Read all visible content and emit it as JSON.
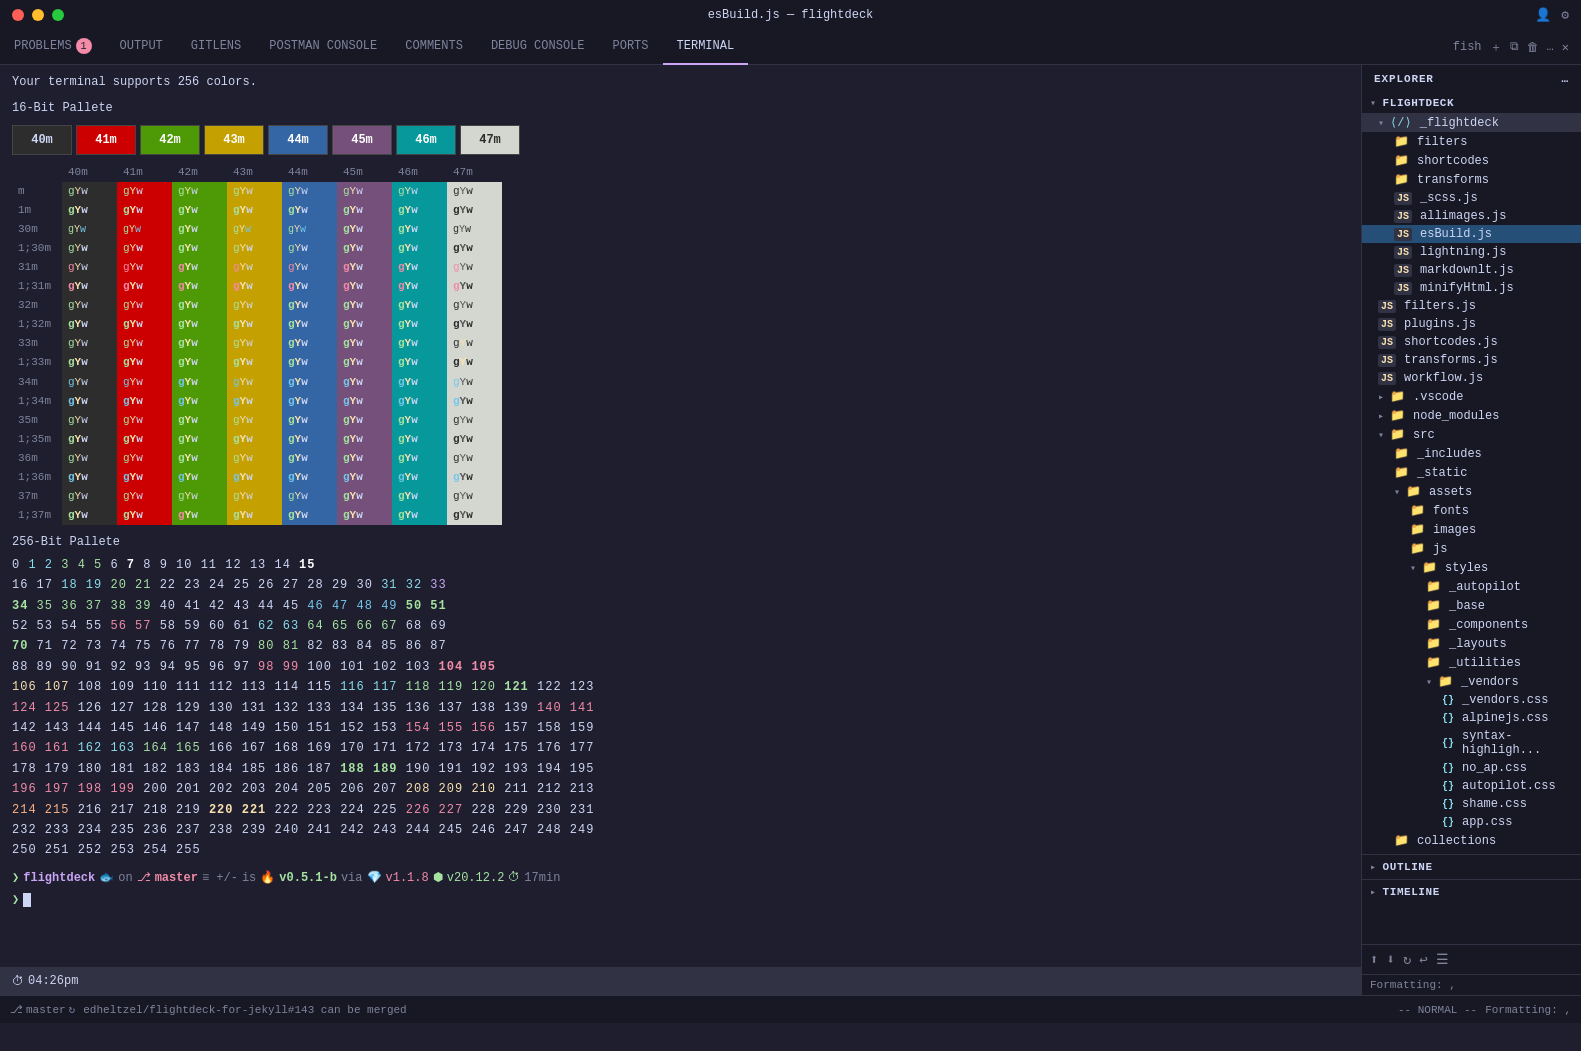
{
  "window": {
    "title": "esBuild.js — flightdeck"
  },
  "traffic_lights": [
    "red",
    "yellow",
    "green"
  ],
  "tabs": [
    {
      "label": "PROBLEMS",
      "badge": "1",
      "active": false
    },
    {
      "label": "OUTPUT",
      "active": false
    },
    {
      "label": "GITLENS",
      "active": false
    },
    {
      "label": "POSTMAN CONSOLE",
      "active": false
    },
    {
      "label": "COMMENTS",
      "active": false
    },
    {
      "label": "DEBUG CONSOLE",
      "active": false
    },
    {
      "label": "PORTS",
      "active": false
    },
    {
      "label": "TERMINAL",
      "active": true
    }
  ],
  "terminal": {
    "line1": "Your terminal supports 256 colors.",
    "section1": "16-Bit Pallete",
    "section2": "256-Bit Pallete",
    "palette_boxes": [
      {
        "label": "40m",
        "bg": "#2d2d2d",
        "color": "#cdd6f4"
      },
      {
        "label": "41m",
        "bg": "#cc0000",
        "color": "#ffffff"
      },
      {
        "label": "42m",
        "bg": "#4e9a06",
        "color": "#ffffff"
      },
      {
        "label": "43m",
        "bg": "#c4a000",
        "color": "#ffffff"
      },
      {
        "label": "44m",
        "bg": "#3465a4",
        "color": "#ffffff"
      },
      {
        "label": "45m",
        "bg": "#75507b",
        "color": "#ffffff"
      },
      {
        "label": "46m",
        "bg": "#06989a",
        "color": "#ffffff"
      },
      {
        "label": "47m",
        "bg": "#d3d7cf",
        "color": "#2d2d2d"
      }
    ]
  },
  "prompt": {
    "arrow": "❯",
    "dir": "flightdeck",
    "git_icon": "⎇",
    "branch": "master",
    "indicator": "≡ +/-",
    "status": "is",
    "version": "v0.5.1-b",
    "via": "via",
    "ruby_icon": "💎",
    "ruby_version": "v1.1.8",
    "node_icon": "⬢",
    "node_version": "v20.12.2",
    "time_icon": "⏱",
    "time": "17min"
  },
  "statusbar": {
    "time": "04:26pm"
  },
  "bottombar": {
    "branch": "master",
    "sync": "↻",
    "pr_label": "edheltzel/flightdeck-for-jekyll#143 can be merged",
    "mode": "-- NORMAL --",
    "formatting": "Formatting: ,"
  },
  "explorer": {
    "title": "EXPLORER",
    "sections": [
      {
        "name": "FLIGHTDECK",
        "expanded": true,
        "items": [
          {
            "type": "folder",
            "label": "_flightdeck",
            "indent": 0,
            "expanded": true
          },
          {
            "type": "folder",
            "label": "filters",
            "indent": 1
          },
          {
            "type": "folder",
            "label": "shortcodes",
            "indent": 1
          },
          {
            "type": "folder",
            "label": "transforms",
            "indent": 1
          },
          {
            "type": "js-file",
            "label": "_scss.js",
            "indent": 1
          },
          {
            "type": "js-file",
            "label": "allimages.js",
            "indent": 1
          },
          {
            "type": "js-file",
            "label": "esBuild.js",
            "indent": 1,
            "active": true
          },
          {
            "type": "js-file",
            "label": "lightning.js",
            "indent": 1
          },
          {
            "type": "js-file",
            "label": "markdownlt.js",
            "indent": 1
          },
          {
            "type": "js-file",
            "label": "minifyHtml.js",
            "indent": 1
          },
          {
            "type": "js-file",
            "label": "filters.js",
            "indent": 0
          },
          {
            "type": "js-file",
            "label": "plugins.js",
            "indent": 0
          },
          {
            "type": "js-file",
            "label": "shortcodes.js",
            "indent": 0
          },
          {
            "type": "js-file",
            "label": "transforms.js",
            "indent": 0
          },
          {
            "type": "js-file",
            "label": "workflow.js",
            "indent": 0
          },
          {
            "type": "folder",
            "label": ".vscode",
            "indent": 0
          },
          {
            "type": "folder",
            "label": "node_modules",
            "indent": 0
          },
          {
            "type": "folder",
            "label": "src",
            "indent": 0,
            "expanded": true
          },
          {
            "type": "folder",
            "label": "_includes",
            "indent": 1
          },
          {
            "type": "folder",
            "label": "_static",
            "indent": 1
          },
          {
            "type": "folder",
            "label": "assets",
            "indent": 1,
            "expanded": true
          },
          {
            "type": "folder",
            "label": "fonts",
            "indent": 2
          },
          {
            "type": "folder",
            "label": "images",
            "indent": 2
          },
          {
            "type": "folder",
            "label": "js",
            "indent": 2
          },
          {
            "type": "folder",
            "label": "styles",
            "indent": 2,
            "expanded": true
          },
          {
            "type": "folder",
            "label": "_autopilot",
            "indent": 3
          },
          {
            "type": "folder",
            "label": "_base",
            "indent": 3
          },
          {
            "type": "folder",
            "label": "_components",
            "indent": 3
          },
          {
            "type": "folder",
            "label": "_layouts",
            "indent": 3
          },
          {
            "type": "folder",
            "label": "_utilities",
            "indent": 3
          },
          {
            "type": "folder",
            "label": "_vendors",
            "indent": 3
          },
          {
            "type": "css-file",
            "label": "_vendors.css",
            "indent": 4
          },
          {
            "type": "css-file",
            "label": "alpinejs.css",
            "indent": 4
          },
          {
            "type": "css-file",
            "label": "syntax-highligh...",
            "indent": 4
          },
          {
            "type": "css-file",
            "label": "no_ap.css",
            "indent": 4
          },
          {
            "type": "css-file",
            "label": "autopilot.css",
            "indent": 4
          },
          {
            "type": "css-file",
            "label": "shame.css",
            "indent": 4
          },
          {
            "type": "css-file",
            "label": "app.css",
            "indent": 4
          },
          {
            "type": "folder",
            "label": "collections",
            "indent": 1
          }
        ]
      }
    ]
  }
}
